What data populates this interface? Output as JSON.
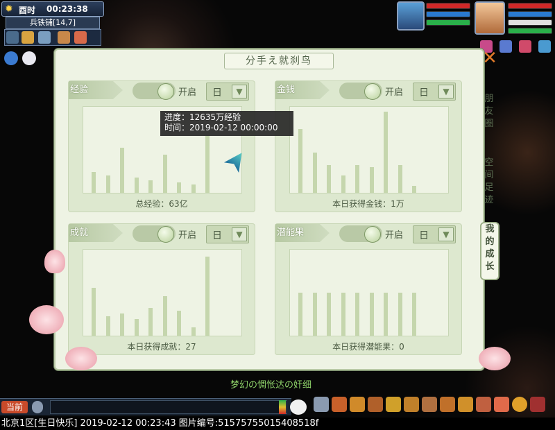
{
  "status": {
    "era": "酉时",
    "time": "00:23:38",
    "location": "兵铁铺[14,7]"
  },
  "panel": {
    "title": "分手え就刹鸟",
    "close_icon": "close-x-icon",
    "side_tabs": [
      "朋友圈",
      "空间足迹",
      "我的成长"
    ],
    "cards": [
      {
        "label": "经验",
        "toggle_label": "开启",
        "period": "日",
        "footer": "总经验：63亿",
        "bars": [
          30,
          25,
          65,
          22,
          18,
          55,
          15,
          12,
          82
        ]
      },
      {
        "label": "金钱",
        "toggle_label": "开启",
        "period": "日",
        "footer": "本日获得金钱：1万",
        "bars": [
          92,
          58,
          40,
          25,
          40,
          37,
          117,
          40,
          10
        ]
      },
      {
        "label": "成就",
        "toggle_label": "开启",
        "period": "日",
        "footer": "本日获得成就：27",
        "bars": [
          69,
          28,
          32,
          24,
          40,
          57,
          36,
          12,
          114
        ]
      },
      {
        "label": "潜能果",
        "toggle_label": "开启",
        "period": "日",
        "footer": "本日获得潜能果：0",
        "bars": [
          62,
          62,
          62,
          62,
          62,
          62,
          62,
          62,
          62
        ]
      }
    ],
    "tooltip": {
      "line1": "进度：12635万经验",
      "line2": "时间：2019-02-12 00:00:00"
    }
  },
  "chat": {
    "channel_label": "当前",
    "message": "梦幻の惆怅达の奸细"
  },
  "footer": {
    "status_line": "北京1区[生日快乐] 2019-02-12 00:23:43 图片编号:51575755015408518f"
  },
  "colors": {
    "panel_bg": "#eef3e4",
    "card_bg": "#dde8cf",
    "bar": "#c5d6ad",
    "close": "#e07a2a",
    "chat_green": "#8fd36a"
  }
}
